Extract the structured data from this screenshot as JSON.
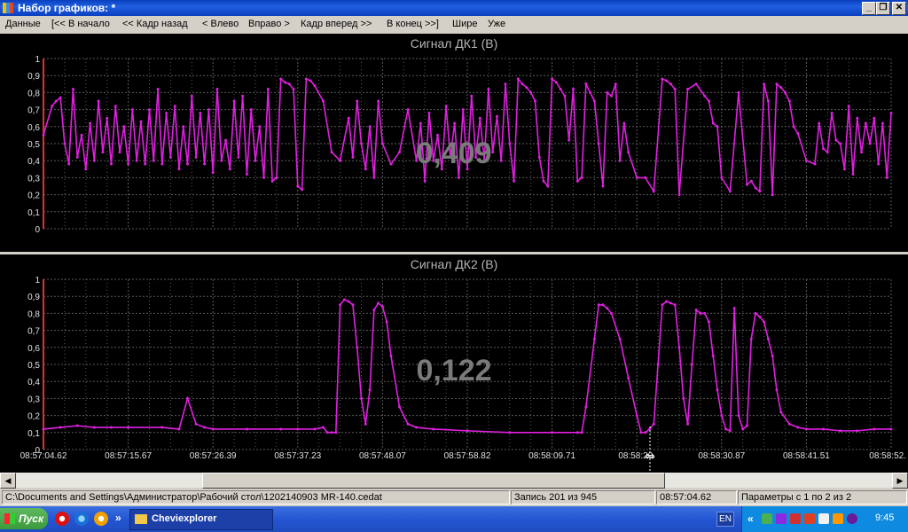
{
  "window": {
    "title": "Набор графиков: *"
  },
  "menu": {
    "items": [
      "Данные",
      "[<< В начало",
      "<< Кадр назад",
      "< Влево",
      "Вправо >",
      "Кадр вперед >>",
      "В конец >>]",
      "Шире",
      "Уже"
    ]
  },
  "charts": [
    {
      "title": "Сигнал ДК1  (В)",
      "current_value": "0,409",
      "y_ticks": [
        "0",
        "0,1",
        "0,2",
        "0,3",
        "0,4",
        "0,5",
        "0,6",
        "0,7",
        "0,8",
        "0,9",
        "1"
      ],
      "line_color": "#e020e0"
    },
    {
      "title": "Сигнал ДК2  (В)",
      "current_value": "0,122",
      "y_ticks": [
        "0",
        "0,1",
        "0,2",
        "0,3",
        "0,4",
        "0,5",
        "0,6",
        "0,7",
        "0,8",
        "0,9",
        "1"
      ],
      "line_color": "#e020e0"
    }
  ],
  "x_axis": {
    "tick_labels": [
      "08:57:04.62",
      "08:57:15.67",
      "08:57:26.39",
      "08:57:37.23",
      "08:57:48.07",
      "08:57:58.82",
      "08:58:09.71",
      "08:58:20.",
      "08:58:30.87",
      "08:58:41.51",
      "08:58:52."
    ]
  },
  "chart_data": [
    {
      "type": "line",
      "title": "Сигнал ДК1  (В)",
      "ylabel": "",
      "ylim": [
        0,
        1
      ],
      "x": [
        0,
        0.01,
        0.015,
        0.02,
        0.025,
        0.03,
        0.035,
        0.04,
        0.045,
        0.05,
        0.055,
        0.06,
        0.065,
        0.07,
        0.075,
        0.08,
        0.085,
        0.09,
        0.095,
        0.1,
        0.105,
        0.11,
        0.115,
        0.12,
        0.125,
        0.13,
        0.135,
        0.14,
        0.145,
        0.15,
        0.155,
        0.16,
        0.165,
        0.17,
        0.175,
        0.18,
        0.185,
        0.19,
        0.195,
        0.2,
        0.205,
        0.21,
        0.215,
        0.22,
        0.225,
        0.23,
        0.235,
        0.24,
        0.245,
        0.25,
        0.255,
        0.26,
        0.265,
        0.27,
        0.275,
        0.28,
        0.285,
        0.29,
        0.295,
        0.3,
        0.305,
        0.31,
        0.315,
        0.32,
        0.33,
        0.34,
        0.35,
        0.36,
        0.365,
        0.37,
        0.375,
        0.38,
        0.385,
        0.39,
        0.395,
        0.4,
        0.41,
        0.42,
        0.43,
        0.44,
        0.445,
        0.45,
        0.455,
        0.46,
        0.465,
        0.47,
        0.475,
        0.48,
        0.485,
        0.49,
        0.495,
        0.5,
        0.505,
        0.51,
        0.515,
        0.52,
        0.525,
        0.53,
        0.535,
        0.54,
        0.545,
        0.55,
        0.555,
        0.56,
        0.565,
        0.57,
        0.575,
        0.58,
        0.585,
        0.59,
        0.595,
        0.6,
        0.605,
        0.61,
        0.615,
        0.62,
        0.625,
        0.63,
        0.635,
        0.64,
        0.645,
        0.65,
        0.655,
        0.66,
        0.665,
        0.67,
        0.675,
        0.68,
        0.685,
        0.69,
        0.7,
        0.71,
        0.72,
        0.73,
        0.735,
        0.74,
        0.745,
        0.75,
        0.76,
        0.77,
        0.78,
        0.785,
        0.79,
        0.795,
        0.8,
        0.81,
        0.82,
        0.83,
        0.835,
        0.84,
        0.845,
        0.85,
        0.855,
        0.86,
        0.865,
        0.87,
        0.875,
        0.88,
        0.885,
        0.89,
        0.9,
        0.91,
        0.915,
        0.92,
        0.925,
        0.93,
        0.935,
        0.94,
        0.945,
        0.95,
        0.955,
        0.96,
        0.965,
        0.97,
        0.975,
        0.98,
        0.985,
        0.99,
        0.995,
        1
      ],
      "series": [
        {
          "values": [
            0.55,
            0.72,
            0.75,
            0.77,
            0.5,
            0.38,
            0.82,
            0.42,
            0.55,
            0.35,
            0.62,
            0.4,
            0.75,
            0.45,
            0.65,
            0.38,
            0.72,
            0.45,
            0.6,
            0.38,
            0.7,
            0.4,
            0.63,
            0.38,
            0.7,
            0.4,
            0.82,
            0.38,
            0.68,
            0.42,
            0.72,
            0.35,
            0.6,
            0.38,
            0.78,
            0.42,
            0.68,
            0.38,
            0.7,
            0.33,
            0.82,
            0.4,
            0.52,
            0.35,
            0.75,
            0.42,
            0.78,
            0.32,
            0.7,
            0.4,
            0.6,
            0.3,
            0.82,
            0.28,
            0.3,
            0.88,
            0.86,
            0.85,
            0.82,
            0.25,
            0.23,
            0.88,
            0.87,
            0.84,
            0.75,
            0.45,
            0.4,
            0.65,
            0.42,
            0.75,
            0.5,
            0.35,
            0.6,
            0.3,
            0.75,
            0.5,
            0.38,
            0.45,
            0.7,
            0.4,
            0.62,
            0.28,
            0.68,
            0.4,
            0.55,
            0.35,
            0.72,
            0.42,
            0.62,
            0.3,
            0.7,
            0.35,
            0.78,
            0.42,
            0.65,
            0.4,
            0.82,
            0.45,
            0.66,
            0.4,
            0.85,
            0.5,
            0.28,
            0.88,
            0.85,
            0.83,
            0.8,
            0.75,
            0.42,
            0.28,
            0.25,
            0.88,
            0.86,
            0.82,
            0.78,
            0.52,
            0.82,
            0.28,
            0.3,
            0.85,
            0.8,
            0.75,
            0.5,
            0.25,
            0.8,
            0.78,
            0.85,
            0.4,
            0.62,
            0.45,
            0.3,
            0.3,
            0.22,
            0.88,
            0.87,
            0.85,
            0.82,
            0.2,
            0.82,
            0.85,
            0.78,
            0.75,
            0.62,
            0.6,
            0.3,
            0.22,
            0.8,
            0.26,
            0.28,
            0.24,
            0.22,
            0.85,
            0.75,
            0.2,
            0.85,
            0.83,
            0.8,
            0.75,
            0.6,
            0.56,
            0.4,
            0.38,
            0.62,
            0.47,
            0.45,
            0.68,
            0.52,
            0.5,
            0.35,
            0.72,
            0.32,
            0.65,
            0.45,
            0.62,
            0.5,
            0.65,
            0.38,
            0.62,
            0.3,
            0.68,
            0.48,
            0.38,
            0.65
          ]
        }
      ],
      "grid": true
    },
    {
      "type": "line",
      "title": "Сигнал ДК2  (В)",
      "ylabel": "",
      "ylim": [
        0,
        1
      ],
      "x": [
        0,
        0.02,
        0.04,
        0.06,
        0.08,
        0.1,
        0.14,
        0.16,
        0.17,
        0.18,
        0.19,
        0.2,
        0.24,
        0.28,
        0.3,
        0.32,
        0.33,
        0.335,
        0.34,
        0.345,
        0.35,
        0.355,
        0.36,
        0.365,
        0.37,
        0.375,
        0.38,
        0.385,
        0.39,
        0.395,
        0.4,
        0.405,
        0.41,
        0.42,
        0.43,
        0.44,
        0.46,
        0.5,
        0.55,
        0.6,
        0.63,
        0.635,
        0.64,
        0.65,
        0.655,
        0.66,
        0.665,
        0.67,
        0.68,
        0.69,
        0.7,
        0.705,
        0.71,
        0.715,
        0.72,
        0.725,
        0.73,
        0.735,
        0.74,
        0.745,
        0.75,
        0.755,
        0.76,
        0.765,
        0.77,
        0.775,
        0.78,
        0.785,
        0.79,
        0.795,
        0.8,
        0.805,
        0.81,
        0.815,
        0.82,
        0.825,
        0.83,
        0.835,
        0.84,
        0.845,
        0.85,
        0.855,
        0.86,
        0.865,
        0.87,
        0.88,
        0.89,
        0.9,
        0.92,
        0.94,
        0.96,
        0.98,
        1
      ],
      "series": [
        {
          "values": [
            0.12,
            0.13,
            0.14,
            0.13,
            0.13,
            0.13,
            0.13,
            0.12,
            0.3,
            0.15,
            0.13,
            0.12,
            0.12,
            0.12,
            0.12,
            0.12,
            0.13,
            0.1,
            0.1,
            0.1,
            0.85,
            0.88,
            0.87,
            0.85,
            0.6,
            0.3,
            0.15,
            0.35,
            0.82,
            0.86,
            0.84,
            0.75,
            0.55,
            0.25,
            0.15,
            0.13,
            0.12,
            0.11,
            0.1,
            0.1,
            0.1,
            0.1,
            0.25,
            0.65,
            0.85,
            0.85,
            0.83,
            0.8,
            0.65,
            0.42,
            0.2,
            0.1,
            0.1,
            0.12,
            0.15,
            0.5,
            0.85,
            0.87,
            0.86,
            0.85,
            0.6,
            0.3,
            0.15,
            0.5,
            0.82,
            0.8,
            0.8,
            0.75,
            0.55,
            0.35,
            0.2,
            0.12,
            0.11,
            0.83,
            0.2,
            0.12,
            0.14,
            0.65,
            0.8,
            0.78,
            0.75,
            0.65,
            0.55,
            0.35,
            0.22,
            0.15,
            0.13,
            0.12,
            0.12,
            0.11,
            0.11,
            0.12,
            0.12
          ]
        }
      ],
      "grid": true
    }
  ],
  "statusbar": {
    "path": "C:\\Documents and Settings\\Администратор\\Рабочий стол\\1202140903 MR-140.cedat",
    "record": "Запись 201 из 945",
    "time": "08:57:04.62",
    "params": "Параметры с 1 по 2 из 2"
  },
  "taskbar": {
    "start_label": "Пуск",
    "task_label": "Cheviexplorer",
    "lang": "EN",
    "clock": "9:45",
    "chevron": "»",
    "tray_chevron": "«"
  }
}
